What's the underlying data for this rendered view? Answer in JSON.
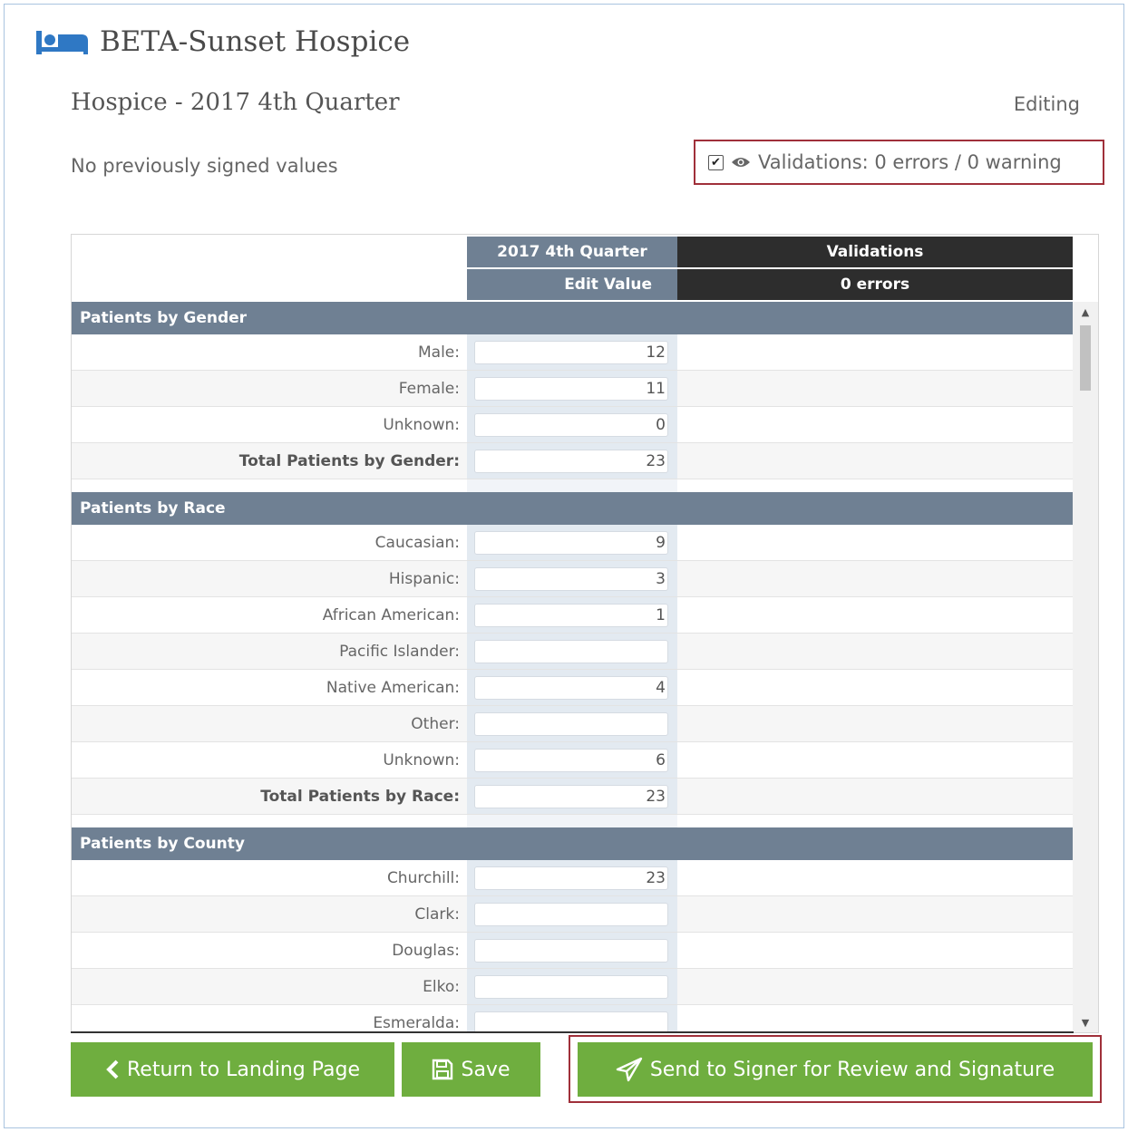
{
  "app": {
    "title": "BETA-Sunset Hospice",
    "icon": "bed-icon"
  },
  "report": {
    "title": "Hospice - 2017 4th Quarter",
    "mode": "Editing",
    "previous_signed": "No previously signed values"
  },
  "validation_toggle": {
    "checked": true,
    "label": "Validations: 0 errors / 0 warning",
    "icon": "eye-icon"
  },
  "table": {
    "headers": {
      "period": "2017 4th Quarter",
      "edit_value": "Edit Value",
      "validations": "Validations",
      "errors": "0 errors"
    },
    "sections": [
      {
        "title": "Patients by Gender",
        "rows": [
          {
            "label": "Male:",
            "value": "12",
            "total": false
          },
          {
            "label": "Female:",
            "value": "11",
            "total": false
          },
          {
            "label": "Unknown:",
            "value": "0",
            "total": false
          },
          {
            "label": "Total Patients by Gender:",
            "value": "23",
            "total": true
          }
        ]
      },
      {
        "title": "Patients by Race",
        "rows": [
          {
            "label": "Caucasian:",
            "value": "9",
            "total": false
          },
          {
            "label": "Hispanic:",
            "value": "3",
            "total": false
          },
          {
            "label": "African American:",
            "value": "1",
            "total": false
          },
          {
            "label": "Pacific Islander:",
            "value": "",
            "total": false
          },
          {
            "label": "Native American:",
            "value": "4",
            "total": false
          },
          {
            "label": "Other:",
            "value": "",
            "total": false
          },
          {
            "label": "Unknown:",
            "value": "6",
            "total": false
          },
          {
            "label": "Total Patients by Race:",
            "value": "23",
            "total": true
          }
        ]
      },
      {
        "title": "Patients by County",
        "rows": [
          {
            "label": "Churchill:",
            "value": "23",
            "total": false
          },
          {
            "label": "Clark:",
            "value": "",
            "total": false
          },
          {
            "label": "Douglas:",
            "value": "",
            "total": false
          },
          {
            "label": "Elko:",
            "value": "",
            "total": false
          },
          {
            "label": "Esmeralda:",
            "value": "",
            "total": false
          }
        ]
      }
    ]
  },
  "buttons": {
    "return_label": "Return to Landing Page",
    "save_label": "Save",
    "send_label": "Send to Signer for Review and Signature"
  },
  "colors": {
    "accent_green": "#6fae3f",
    "section_header": "#6f8093",
    "validation_header": "#2d2d2d",
    "highlight_outline": "#a0303a"
  }
}
